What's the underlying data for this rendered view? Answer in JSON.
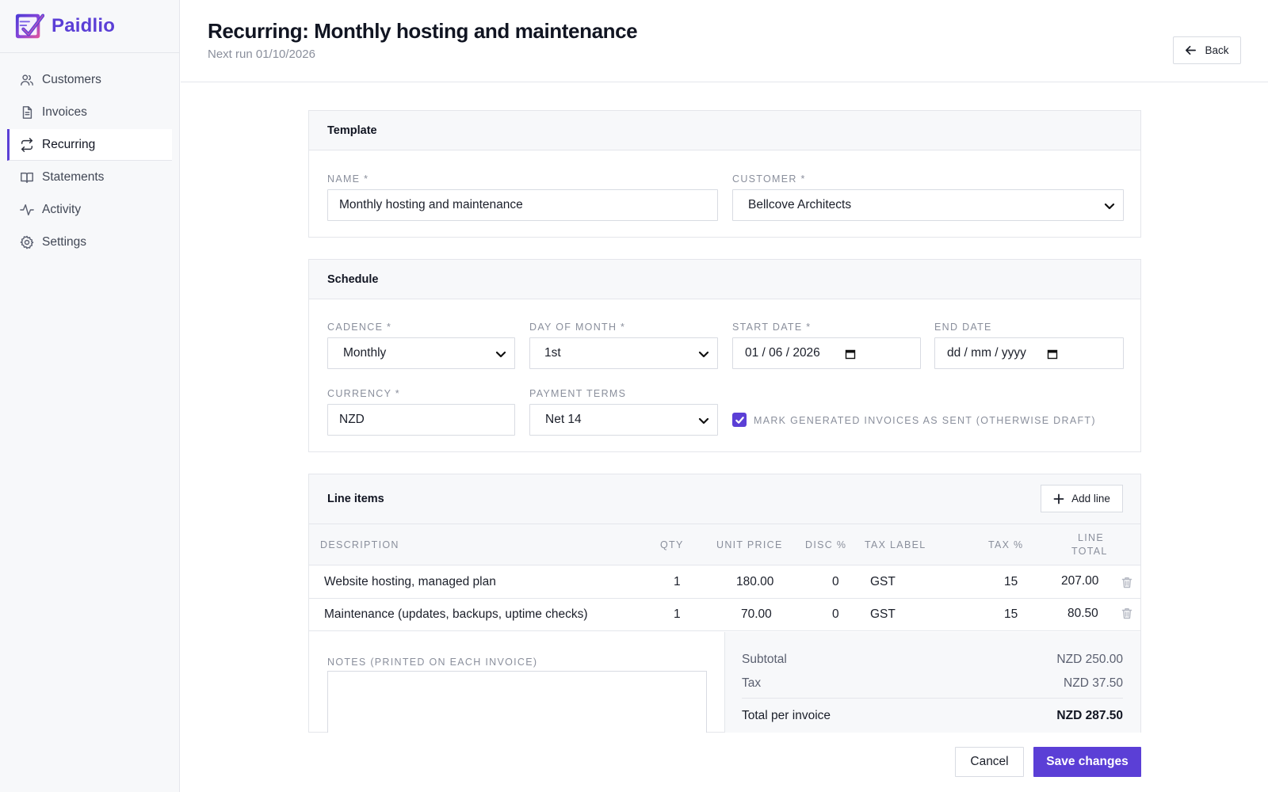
{
  "app": {
    "name": "Paidlio"
  },
  "sidebar": {
    "items": [
      {
        "label": "Customers",
        "icon": "users-icon"
      },
      {
        "label": "Invoices",
        "icon": "document-icon"
      },
      {
        "label": "Recurring",
        "icon": "repeat-icon",
        "active": true
      },
      {
        "label": "Statements",
        "icon": "book-icon"
      },
      {
        "label": "Activity",
        "icon": "activity-icon"
      },
      {
        "label": "Settings",
        "icon": "gear-icon"
      }
    ]
  },
  "header": {
    "title": "Recurring: Monthly hosting and maintenance",
    "subtitle": "Next run 01/10/2026",
    "back_label": "Back"
  },
  "template": {
    "heading": "Template",
    "name_label": "NAME *",
    "name_value": "Monthly hosting and maintenance",
    "customer_label": "CUSTOMER *",
    "customer_value": "Bellcove Architects"
  },
  "schedule": {
    "heading": "Schedule",
    "cadence_label": "CADENCE *",
    "cadence_value": "Monthly",
    "day_label": "DAY OF MONTH *",
    "day_value": "1st",
    "start_label": "START DATE *",
    "start_value": "01 / 06 / 2026",
    "end_label": "END DATE",
    "end_placeholder": "dd / mm / yyyy",
    "currency_label": "CURRENCY *",
    "currency_value": "NZD",
    "terms_label": "PAYMENT TERMS",
    "terms_value": "Net 14",
    "mark_sent_label": "MARK GENERATED INVOICES AS SENT (OTHERWISE DRAFT)",
    "mark_sent_checked": true
  },
  "line_items": {
    "heading": "Line items",
    "add_label": "Add line",
    "columns": {
      "description": "DESCRIPTION",
      "qty": "QTY",
      "unit_price": "UNIT PRICE",
      "disc": "DISC %",
      "tax_label": "TAX LABEL",
      "tax_pct": "TAX %",
      "line_total_1": "LINE",
      "line_total_2": "TOTAL"
    },
    "rows": [
      {
        "description": "Website hosting, managed plan",
        "qty": "1",
        "unit_price": "180.00",
        "disc": "0",
        "tax_label": "GST",
        "tax_pct": "15",
        "line_total": "207.00"
      },
      {
        "description": "Maintenance (updates, backups, uptime checks)",
        "qty": "1",
        "unit_price": "70.00",
        "disc": "0",
        "tax_label": "GST",
        "tax_pct": "15",
        "line_total": "80.50"
      }
    ]
  },
  "notes": {
    "label": "NOTES (PRINTED ON EACH INVOICE)",
    "value": ""
  },
  "totals": {
    "subtotal_label": "Subtotal",
    "subtotal_value": "NZD 250.00",
    "tax_label": "Tax",
    "tax_value": "NZD 37.50",
    "total_label": "Total per invoice",
    "total_value": "NZD 287.50"
  },
  "actions": {
    "cancel_label": "Cancel",
    "save_label": "Save changes"
  },
  "colors": {
    "accent": "#5b3fd6",
    "muted": "#8a8f9c",
    "border": "#e4e6eb"
  }
}
